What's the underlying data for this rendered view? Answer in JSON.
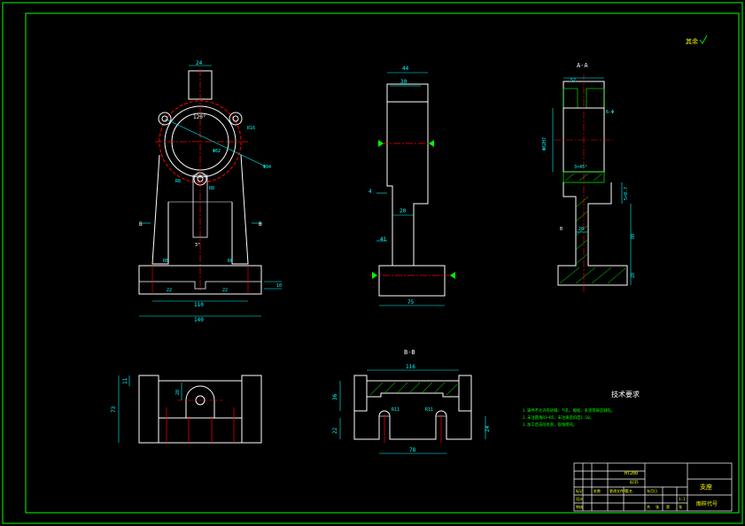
{
  "colors": {
    "background": "#000000",
    "outline": "#ffffff",
    "frame": "#00ff00",
    "dimension": "#00ffff",
    "centerline": "#ff0000",
    "hatch": "#00ff00",
    "text_yellow": "#ffff00",
    "accent_green": "#00ff00"
  },
  "top_right_note": "其余",
  "views": {
    "front": {
      "dims": {
        "top_width": "24",
        "angle": "120°",
        "radius_top": "R16",
        "diameter": "Φ94",
        "d1": "Φ62",
        "r2": "R8",
        "r3": "R6",
        "r4": "R8",
        "center_mark": "3°",
        "r_left": "R2",
        "r_right": "R2",
        "r6": "R6",
        "r7": "R6",
        "base_inner_left": "22",
        "base_inner_mid": "22",
        "base_height": "10",
        "base_slot": "110",
        "base_width": "140",
        "section_left": "B",
        "section_right": "B"
      }
    },
    "side": {
      "dims": {
        "top_width": "44",
        "inner_width": "30",
        "mid_width": "20",
        "left_gap": "4",
        "step": "41",
        "base_length": "75"
      }
    },
    "section_aa": {
      "title": "A-A",
      "dims": {
        "top": "52",
        "chamfer": "3×45°",
        "bore": "Φ62H7",
        "right_off": "6-Φ",
        "mid_h": "5×0.7",
        "web_w": "20",
        "web_label": "B",
        "height": "80",
        "base_h": "28"
      }
    },
    "top": {
      "dims": {
        "left_offset": "11",
        "total_height": "73",
        "mid": "28"
      }
    },
    "section_bb": {
      "title": "B-B",
      "dims": {
        "top_width": "116",
        "left_h": "36",
        "r_left": "R11",
        "r_right": "R11",
        "base_left": "22",
        "bottom_width": "78",
        "right_h": "24"
      }
    }
  },
  "tech_requirements": {
    "title": "技术要求",
    "items": [
      "1.铸件不允许有砂眼、气孔、缩松、夹渣等铸造缺陷。",
      "2.未注圆角R3~R5，未注铸造斜度1:10。",
      "3.加工后去除毛刺，锐角倒钝。"
    ]
  },
  "title_block": {
    "material": "HT200",
    "code": "Q235",
    "part_name": "支座",
    "drawing_no": "图样代号",
    "row_labels": [
      "标记",
      "设计",
      "审核",
      "工艺"
    ],
    "cols": [
      "处数",
      "分区",
      "更改文件号",
      "签名",
      "年月日"
    ],
    "bottom": [
      "共",
      "张",
      "第",
      "张"
    ],
    "scale": "1:1"
  }
}
